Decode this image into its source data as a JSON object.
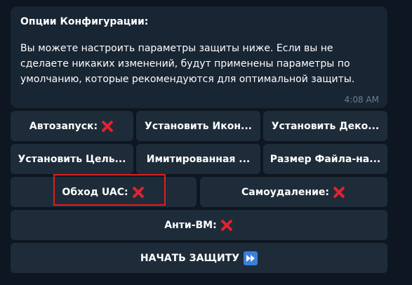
{
  "message": {
    "title": "Опции Конфигурации:",
    "body": "Вы можете настроить параметры защиты ниже. Если вы не сделаете никаких изменений, будут применены параметры по умолчанию, которые рекомендуются для оптимальной защиты.",
    "time": "4:08 AM"
  },
  "keyboard": {
    "rows": [
      [
        {
          "label": "Автозапуск:",
          "icon": "red-x-icon"
        },
        {
          "label": "Установить Икон..."
        },
        {
          "label": "Установить Деко..."
        }
      ],
      [
        {
          "label": "Установить Цель..."
        },
        {
          "label": "Имитированная ..."
        },
        {
          "label": "Размер Файла-на..."
        }
      ],
      [
        {
          "label": "Обход UAC:",
          "icon": "red-x-icon",
          "highlighted": true
        },
        {
          "label": "Самоудаление:",
          "icon": "red-x-icon"
        }
      ],
      [
        {
          "label": "Анти-ВМ:",
          "icon": "red-x-icon"
        }
      ],
      [
        {
          "label": "НАЧАТЬ ЗАЩИТУ",
          "icon": "fast-forward-icon"
        }
      ]
    ]
  },
  "colors": {
    "background": "#0e1621",
    "bubble": "#182533",
    "button": "#1e2c3a",
    "x_mark": "#e0242e",
    "highlight": "#e01e1e",
    "timestamp": "#6d7f8f"
  }
}
